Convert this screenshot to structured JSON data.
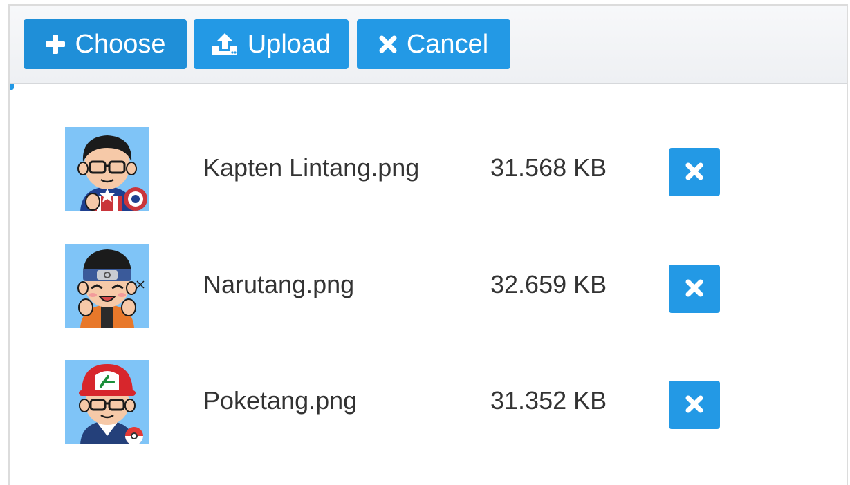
{
  "toolbar": {
    "choose_label": "Choose",
    "upload_label": "Upload",
    "cancel_label": "Cancel"
  },
  "files": [
    {
      "name": "Kapten Lintang.png",
      "size": "31.568 KB",
      "avatar": "captain-avatar"
    },
    {
      "name": "Narutang.png",
      "size": "32.659 KB",
      "avatar": "ninja-avatar"
    },
    {
      "name": "Poketang.png",
      "size": "31.352 KB",
      "avatar": "trainer-avatar"
    }
  ],
  "colors": {
    "accent": "#2399e5",
    "thumb_bg": "#7fc4f7",
    "text": "#333333"
  },
  "icons": {
    "choose": "plus-icon",
    "upload": "upload-icon",
    "cancel": "times-icon",
    "remove": "times-icon"
  }
}
